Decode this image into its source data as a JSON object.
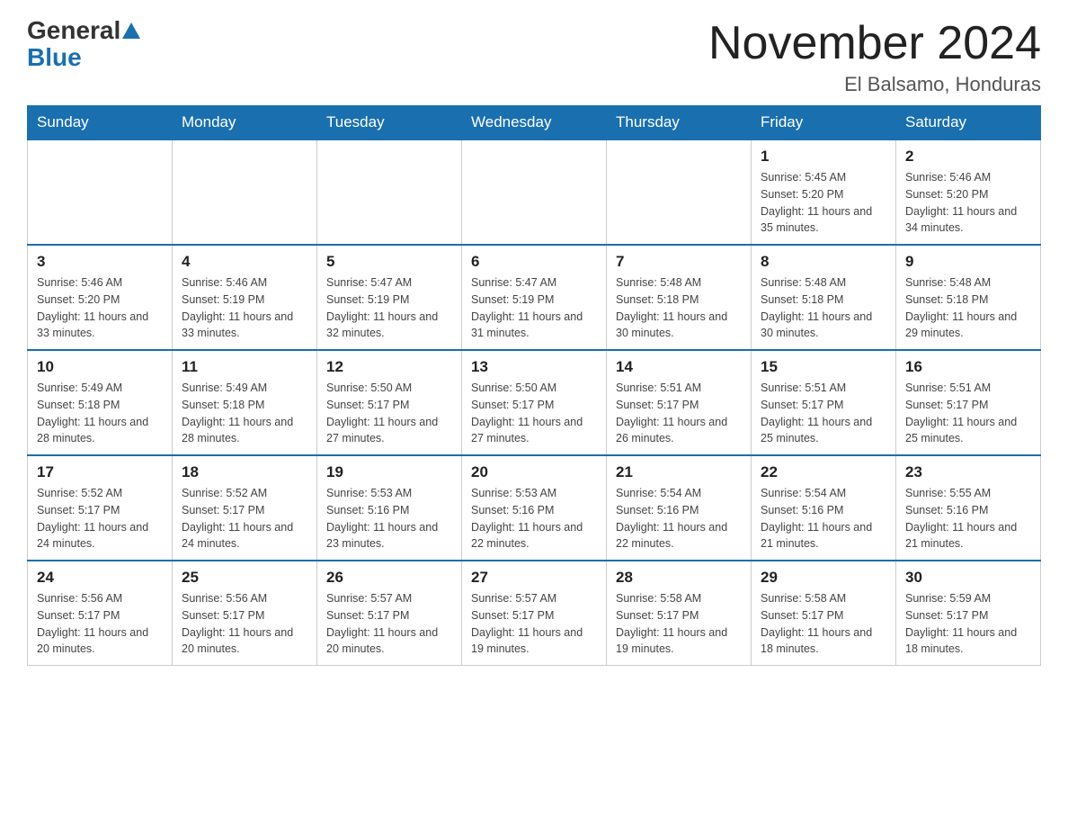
{
  "header": {
    "logo": {
      "general": "General",
      "blue": "Blue"
    },
    "title": "November 2024",
    "location": "El Balsamo, Honduras"
  },
  "days_of_week": [
    "Sunday",
    "Monday",
    "Tuesday",
    "Wednesday",
    "Thursday",
    "Friday",
    "Saturday"
  ],
  "weeks": [
    {
      "days": [
        {
          "number": "",
          "info": ""
        },
        {
          "number": "",
          "info": ""
        },
        {
          "number": "",
          "info": ""
        },
        {
          "number": "",
          "info": ""
        },
        {
          "number": "",
          "info": ""
        },
        {
          "number": "1",
          "info": "Sunrise: 5:45 AM\nSunset: 5:20 PM\nDaylight: 11 hours and 35 minutes."
        },
        {
          "number": "2",
          "info": "Sunrise: 5:46 AM\nSunset: 5:20 PM\nDaylight: 11 hours and 34 minutes."
        }
      ]
    },
    {
      "days": [
        {
          "number": "3",
          "info": "Sunrise: 5:46 AM\nSunset: 5:20 PM\nDaylight: 11 hours and 33 minutes."
        },
        {
          "number": "4",
          "info": "Sunrise: 5:46 AM\nSunset: 5:19 PM\nDaylight: 11 hours and 33 minutes."
        },
        {
          "number": "5",
          "info": "Sunrise: 5:47 AM\nSunset: 5:19 PM\nDaylight: 11 hours and 32 minutes."
        },
        {
          "number": "6",
          "info": "Sunrise: 5:47 AM\nSunset: 5:19 PM\nDaylight: 11 hours and 31 minutes."
        },
        {
          "number": "7",
          "info": "Sunrise: 5:48 AM\nSunset: 5:18 PM\nDaylight: 11 hours and 30 minutes."
        },
        {
          "number": "8",
          "info": "Sunrise: 5:48 AM\nSunset: 5:18 PM\nDaylight: 11 hours and 30 minutes."
        },
        {
          "number": "9",
          "info": "Sunrise: 5:48 AM\nSunset: 5:18 PM\nDaylight: 11 hours and 29 minutes."
        }
      ]
    },
    {
      "days": [
        {
          "number": "10",
          "info": "Sunrise: 5:49 AM\nSunset: 5:18 PM\nDaylight: 11 hours and 28 minutes."
        },
        {
          "number": "11",
          "info": "Sunrise: 5:49 AM\nSunset: 5:18 PM\nDaylight: 11 hours and 28 minutes."
        },
        {
          "number": "12",
          "info": "Sunrise: 5:50 AM\nSunset: 5:17 PM\nDaylight: 11 hours and 27 minutes."
        },
        {
          "number": "13",
          "info": "Sunrise: 5:50 AM\nSunset: 5:17 PM\nDaylight: 11 hours and 27 minutes."
        },
        {
          "number": "14",
          "info": "Sunrise: 5:51 AM\nSunset: 5:17 PM\nDaylight: 11 hours and 26 minutes."
        },
        {
          "number": "15",
          "info": "Sunrise: 5:51 AM\nSunset: 5:17 PM\nDaylight: 11 hours and 25 minutes."
        },
        {
          "number": "16",
          "info": "Sunrise: 5:51 AM\nSunset: 5:17 PM\nDaylight: 11 hours and 25 minutes."
        }
      ]
    },
    {
      "days": [
        {
          "number": "17",
          "info": "Sunrise: 5:52 AM\nSunset: 5:17 PM\nDaylight: 11 hours and 24 minutes."
        },
        {
          "number": "18",
          "info": "Sunrise: 5:52 AM\nSunset: 5:17 PM\nDaylight: 11 hours and 24 minutes."
        },
        {
          "number": "19",
          "info": "Sunrise: 5:53 AM\nSunset: 5:16 PM\nDaylight: 11 hours and 23 minutes."
        },
        {
          "number": "20",
          "info": "Sunrise: 5:53 AM\nSunset: 5:16 PM\nDaylight: 11 hours and 22 minutes."
        },
        {
          "number": "21",
          "info": "Sunrise: 5:54 AM\nSunset: 5:16 PM\nDaylight: 11 hours and 22 minutes."
        },
        {
          "number": "22",
          "info": "Sunrise: 5:54 AM\nSunset: 5:16 PM\nDaylight: 11 hours and 21 minutes."
        },
        {
          "number": "23",
          "info": "Sunrise: 5:55 AM\nSunset: 5:16 PM\nDaylight: 11 hours and 21 minutes."
        }
      ]
    },
    {
      "days": [
        {
          "number": "24",
          "info": "Sunrise: 5:56 AM\nSunset: 5:17 PM\nDaylight: 11 hours and 20 minutes."
        },
        {
          "number": "25",
          "info": "Sunrise: 5:56 AM\nSunset: 5:17 PM\nDaylight: 11 hours and 20 minutes."
        },
        {
          "number": "26",
          "info": "Sunrise: 5:57 AM\nSunset: 5:17 PM\nDaylight: 11 hours and 20 minutes."
        },
        {
          "number": "27",
          "info": "Sunrise: 5:57 AM\nSunset: 5:17 PM\nDaylight: 11 hours and 19 minutes."
        },
        {
          "number": "28",
          "info": "Sunrise: 5:58 AM\nSunset: 5:17 PM\nDaylight: 11 hours and 19 minutes."
        },
        {
          "number": "29",
          "info": "Sunrise: 5:58 AM\nSunset: 5:17 PM\nDaylight: 11 hours and 18 minutes."
        },
        {
          "number": "30",
          "info": "Sunrise: 5:59 AM\nSunset: 5:17 PM\nDaylight: 11 hours and 18 minutes."
        }
      ]
    }
  ]
}
